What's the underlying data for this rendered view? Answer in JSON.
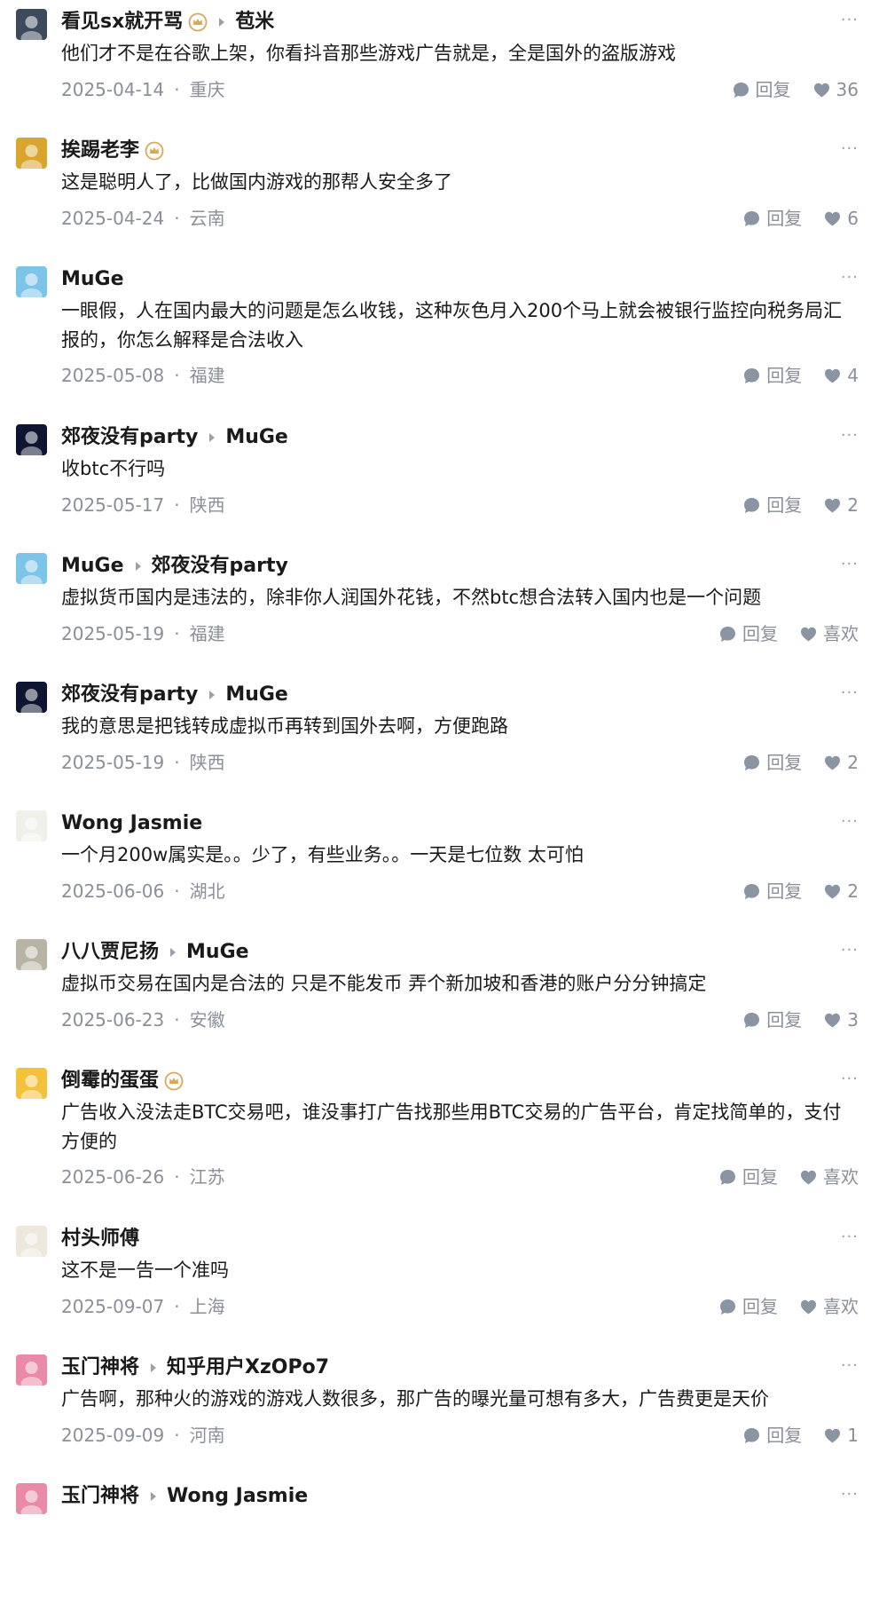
{
  "comments": [
    {
      "author": "看见sx就开骂",
      "badge": true,
      "reply_to": "苞米",
      "text": "他们才不是在谷歌上架，你看抖音那些游戏广告就是，全是国外的盗版游戏",
      "date": "2025-04-14",
      "location": "重庆",
      "reply_label": "回复",
      "like_label": "36",
      "avatar_color": "#3d4a5c"
    },
    {
      "author": "挨踢老李",
      "badge": true,
      "reply_to": "",
      "text": "这是聪明人了，比做国内游戏的那帮人安全多了",
      "date": "2025-04-24",
      "location": "云南",
      "reply_label": "回复",
      "like_label": "6",
      "avatar_color": "#d9a52b"
    },
    {
      "author": "MuGe",
      "badge": false,
      "reply_to": "",
      "text": "一眼假，人在国内最大的问题是怎么收钱，这种灰色月入200个马上就会被银行监控向税务局汇报的，你怎么解释是合法收入",
      "date": "2025-05-08",
      "location": "福建",
      "reply_label": "回复",
      "like_label": "4",
      "avatar_color": "#7cc4e8"
    },
    {
      "author": "郊夜没有party",
      "badge": false,
      "reply_to": "MuGe",
      "text": "收btc不行吗",
      "date": "2025-05-17",
      "location": "陕西",
      "reply_label": "回复",
      "like_label": "2",
      "avatar_color": "#0d1530"
    },
    {
      "author": "MuGe",
      "badge": false,
      "reply_to": "郊夜没有party",
      "text": "虚拟货币国内是违法的，除非你人润国外花钱，不然btc想合法转入国内也是一个问题",
      "date": "2025-05-19",
      "location": "福建",
      "reply_label": "回复",
      "like_label": "喜欢",
      "avatar_color": "#7cc4e8"
    },
    {
      "author": "郊夜没有party",
      "badge": false,
      "reply_to": "MuGe",
      "text": "我的意思是把钱转成虚拟币再转到国外去啊，方便跑路",
      "date": "2025-05-19",
      "location": "陕西",
      "reply_label": "回复",
      "like_label": "2",
      "avatar_color": "#0d1530"
    },
    {
      "author": "Wong Jasmie",
      "badge": false,
      "reply_to": "",
      "text": "一个月200w属实是。。少了，有些业务。。一天是七位数 太可怕",
      "date": "2025-06-06",
      "location": "湖北",
      "reply_label": "回复",
      "like_label": "2",
      "avatar_color": "#f0f0ea"
    },
    {
      "author": "八八贾尼扬",
      "badge": false,
      "reply_to": "MuGe",
      "text": "虚拟币交易在国内是合法的 只是不能发币 弄个新加坡和香港的账户分分钟搞定",
      "date": "2025-06-23",
      "location": "安徽",
      "reply_label": "回复",
      "like_label": "3",
      "avatar_color": "#b8b4a4"
    },
    {
      "author": "倒霉的蛋蛋",
      "badge": true,
      "reply_to": "",
      "text": "广告收入没法走BTC交易吧，谁没事打广告找那些用BTC交易的广告平台，肯定找简单的，支付方便的",
      "date": "2025-06-26",
      "location": "江苏",
      "reply_label": "回复",
      "like_label": "喜欢",
      "avatar_color": "#f3c23a"
    },
    {
      "author": "村头师傅",
      "badge": false,
      "reply_to": "",
      "text": "这不是一告一个准吗",
      "date": "2025-09-07",
      "location": "上海",
      "reply_label": "回复",
      "like_label": "喜欢",
      "avatar_color": "#ede7dc"
    },
    {
      "author": "玉门神将",
      "badge": false,
      "reply_to": "知乎用户XzOPo7",
      "text": "广告啊，那种火的游戏的游戏人数很多，那广告的曝光量可想有多大，广告费更是天价",
      "date": "2025-09-09",
      "location": "河南",
      "reply_label": "回复",
      "like_label": "1",
      "avatar_color": "#e88aa8"
    },
    {
      "author": "玉门神将",
      "badge": false,
      "reply_to": "Wong Jasmie",
      "text": "",
      "date": "",
      "location": "",
      "reply_label": "",
      "like_label": "",
      "avatar_color": "#e88aa8"
    }
  ],
  "more_label": "···",
  "separator": "·",
  "icons": {
    "reply": "speech-bubble-icon",
    "like": "heart-icon",
    "badge": "crown-badge-icon",
    "more": "more-dots-icon"
  },
  "colors": {
    "meta": "#8a8f99",
    "badge": "#d9a85a",
    "icon": "#8a94a3"
  }
}
